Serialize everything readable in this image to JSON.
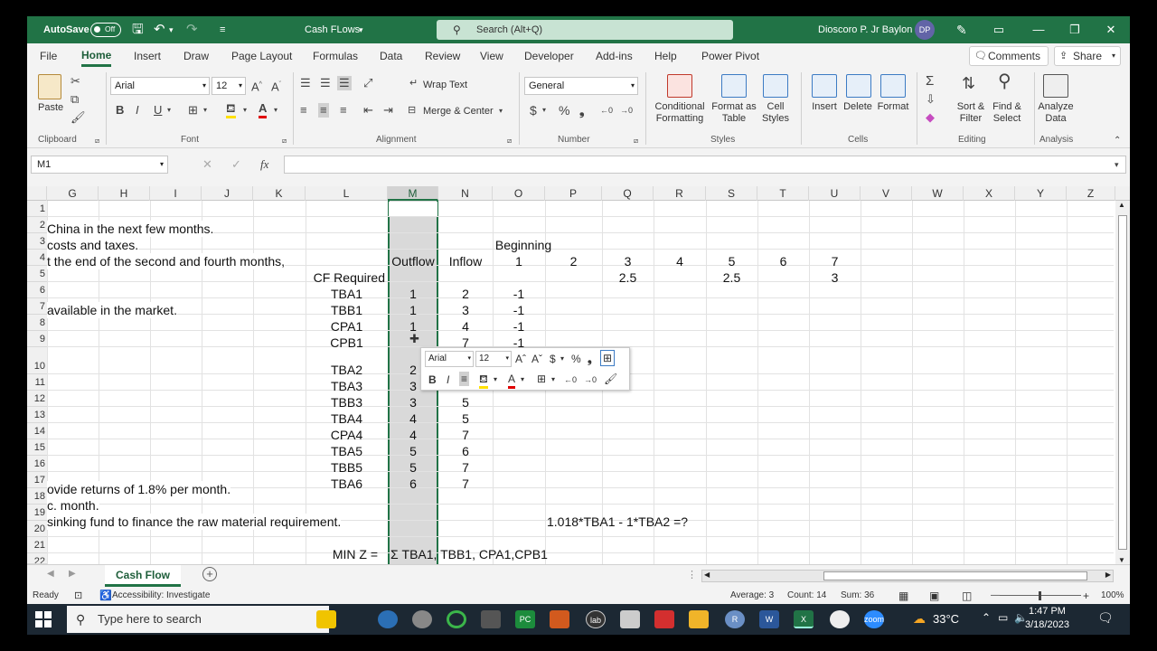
{
  "titlebar": {
    "autosave_label": "AutoSave",
    "autosave_state": "Off",
    "file_name": "Cash FLows",
    "search_placeholder": "Search (Alt+Q)",
    "user_name": "Dioscoro P. Jr Baylon",
    "user_initials": "DP"
  },
  "menu": {
    "tabs": [
      "File",
      "Home",
      "Insert",
      "Draw",
      "Page Layout",
      "Formulas",
      "Data",
      "Review",
      "View",
      "Developer",
      "Add-ins",
      "Help",
      "Power Pivot"
    ],
    "comments_label": "Comments",
    "share_label": "Share"
  },
  "ribbon": {
    "paste_label": "Paste",
    "font_name": "Arial",
    "font_size": "12",
    "wrap_text_label": "Wrap Text",
    "merge_center_label": "Merge & Center",
    "number_format": "General",
    "conditional_formatting_label": "Conditional Formatting",
    "format_as_table_label": "Format as Table",
    "cell_styles_label": "Cell Styles",
    "insert_label": "Insert",
    "delete_label": "Delete",
    "format_label": "Format",
    "sort_filter_label": "Sort & Filter",
    "find_select_label": "Find & Select",
    "analyze_data_label": "Analyze Data",
    "groups": {
      "clipboard": "Clipboard",
      "font": "Font",
      "alignment": "Alignment",
      "number": "Number",
      "styles": "Styles",
      "cells": "Cells",
      "editing": "Editing",
      "analysis": "Analysis"
    }
  },
  "formula_bar": {
    "name_box": "M1",
    "fx_label": "fx",
    "formula": ""
  },
  "grid": {
    "columns": [
      "G",
      "H",
      "I",
      "J",
      "K",
      "L",
      "M",
      "N",
      "O",
      "P",
      "Q",
      "R",
      "S",
      "T",
      "U",
      "V",
      "W",
      "X",
      "Y",
      "Z"
    ],
    "rows": [
      "1",
      "2",
      "3",
      "4",
      "5",
      "6",
      "7",
      "8",
      "9",
      "10",
      "11",
      "12",
      "13",
      "14",
      "15",
      "16",
      "17",
      "18",
      "19",
      "20",
      "21",
      "22"
    ],
    "text_cells": {
      "g2": "China in the next few months.",
      "g3": "costs and taxes.",
      "g4": "t the end of the second and fourth months,",
      "g7": "available in the market.",
      "g17": "ovide returns of 1.8% per month.",
      "g18": "c. month.",
      "g19": "sinking fund to finance the raw material requirement.",
      "l5": "CF Required",
      "l21": "MIN Z =",
      "m21": "Σ TBA1, TBB1, CPA1,CPB1",
      "o3": "Beginning",
      "p19": "1.018*TBA1 - 1*TBA2 =?"
    },
    "header_row4": [
      "Outflow",
      "Inflow",
      "1",
      "2",
      "3",
      "4",
      "5",
      "6",
      "7"
    ],
    "row5_values": {
      "q": "2.5",
      "s": "2.5",
      "u": "3"
    },
    "instruments": [
      {
        "name": "TBA1",
        "outflow": "1",
        "inflow": "2",
        "o": "-1"
      },
      {
        "name": "TBB1",
        "outflow": "1",
        "inflow": "3",
        "o": "-1"
      },
      {
        "name": "CPA1",
        "outflow": "1",
        "inflow": "4",
        "o": "-1"
      },
      {
        "name": "CPB1",
        "outflow": "",
        "inflow": "7",
        "o": "-1"
      },
      {
        "name": "TBA2",
        "outflow": "2",
        "inflow": "",
        "o": ""
      },
      {
        "name": "TBA3",
        "outflow": "3",
        "inflow": "",
        "o": ""
      },
      {
        "name": "TBB3",
        "outflow": "3",
        "inflow": "5",
        "o": ""
      },
      {
        "name": "TBA4",
        "outflow": "4",
        "inflow": "5",
        "o": ""
      },
      {
        "name": "CPA4",
        "outflow": "4",
        "inflow": "7",
        "o": ""
      },
      {
        "name": "TBA5",
        "outflow": "5",
        "inflow": "6",
        "o": ""
      },
      {
        "name": "TBB5",
        "outflow": "5",
        "inflow": "7",
        "o": ""
      },
      {
        "name": "TBA6",
        "outflow": "6",
        "inflow": "7",
        "o": ""
      }
    ]
  },
  "mini_toolbar": {
    "font": "Arial",
    "size": "12"
  },
  "sheet": {
    "tab_name": "Cash Flow"
  },
  "status": {
    "mode": "Ready",
    "accessibility": "Accessibility: Investigate",
    "average": "Average: 3",
    "count": "Count: 14",
    "sum": "Sum: 36",
    "zoom": "100%"
  },
  "taskbar": {
    "search_placeholder": "Type here to search",
    "temperature": "33°C",
    "time": "1:47 PM",
    "date": "3/18/2023"
  },
  "colors": {
    "excel_green": "#217346",
    "selection_gray": "#d9d9d9"
  }
}
